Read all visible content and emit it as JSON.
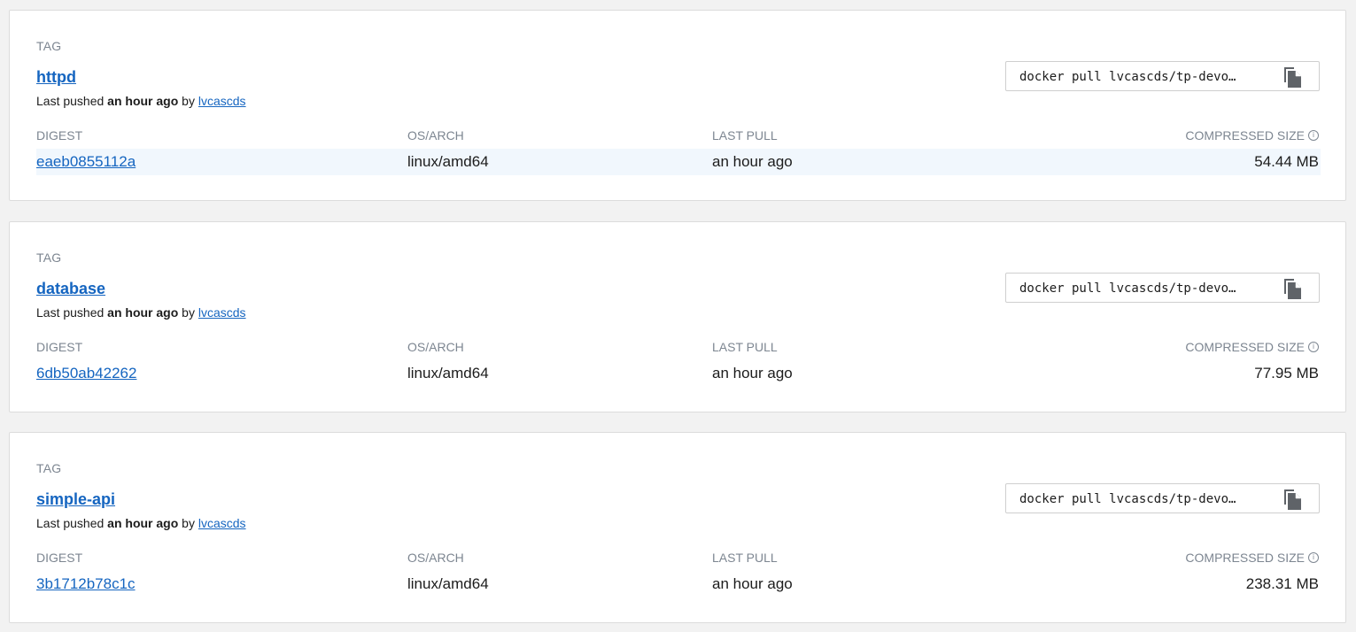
{
  "colors": {
    "link": "#1565c0",
    "muted": "#7d8691",
    "highlight_row": "#f1f7fd"
  },
  "tags": [
    {
      "tag_label": "TAG",
      "name": "httpd",
      "pushed_prefix": "Last pushed ",
      "pushed_time": "an hour ago",
      "pushed_by": " by ",
      "user": "lvcascds",
      "pull_command": "docker pull lvcascds/tp-devo…",
      "copy_icon": "copy-icon",
      "headers": {
        "digest": "DIGEST",
        "osarch": "OS/ARCH",
        "last_pull": "LAST PULL",
        "size": "COMPRESSED SIZE"
      },
      "digest": "eaeb0855112a",
      "osarch": "linux/amd64",
      "last_pull": "an hour ago",
      "size": "54.44 MB",
      "highlighted": true
    },
    {
      "tag_label": "TAG",
      "name": "database",
      "pushed_prefix": "Last pushed ",
      "pushed_time": "an hour ago",
      "pushed_by": " by ",
      "user": "lvcascds",
      "pull_command": "docker pull lvcascds/tp-devo…",
      "copy_icon": "copy-icon",
      "headers": {
        "digest": "DIGEST",
        "osarch": "OS/ARCH",
        "last_pull": "LAST PULL",
        "size": "COMPRESSED SIZE"
      },
      "digest": "6db50ab42262",
      "osarch": "linux/amd64",
      "last_pull": "an hour ago",
      "size": "77.95 MB",
      "highlighted": false
    },
    {
      "tag_label": "TAG",
      "name": "simple-api",
      "pushed_prefix": "Last pushed ",
      "pushed_time": "an hour ago",
      "pushed_by": " by ",
      "user": "lvcascds",
      "pull_command": "docker pull lvcascds/tp-devo…",
      "copy_icon": "copy-icon",
      "headers": {
        "digest": "DIGEST",
        "osarch": "OS/ARCH",
        "last_pull": "LAST PULL",
        "size": "COMPRESSED SIZE"
      },
      "digest": "3b1712b78c1c",
      "osarch": "linux/amd64",
      "last_pull": "an hour ago",
      "size": "238.31 MB",
      "highlighted": false
    }
  ]
}
